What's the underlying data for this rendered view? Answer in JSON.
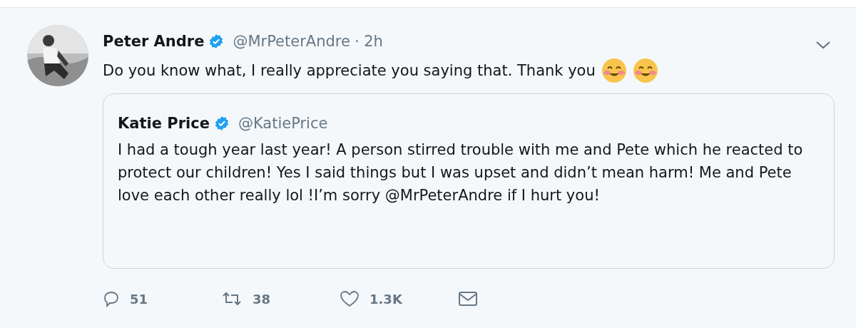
{
  "tweet": {
    "author": {
      "name": "Peter Andre",
      "verified": true,
      "handle": "@MrPeterAndre",
      "time": "· 2h"
    },
    "text": "Do you know what, I really appreciate you saying that. Thank you",
    "emojis": [
      {
        "kind": "smiling-face"
      },
      {
        "kind": "smiling-face"
      }
    ],
    "quoted_tweet": {
      "author": {
        "name": "Katie Price",
        "verified": true,
        "handle": "@KatiePrice"
      },
      "text": "I had a tough year last year! A person stirred trouble with me and Pete which he reacted to protect our children! Yes I said things but I was upset and didn’t mean harm! Me and Pete love each other really lol !I’m sorry @MrPeterAndre if I hurt you!"
    },
    "actions": [
      {
        "kind": "reply",
        "count": "51"
      },
      {
        "kind": "retweet",
        "count": "38"
      },
      {
        "kind": "like",
        "count": "1.3K"
      },
      {
        "kind": "message"
      }
    ]
  }
}
